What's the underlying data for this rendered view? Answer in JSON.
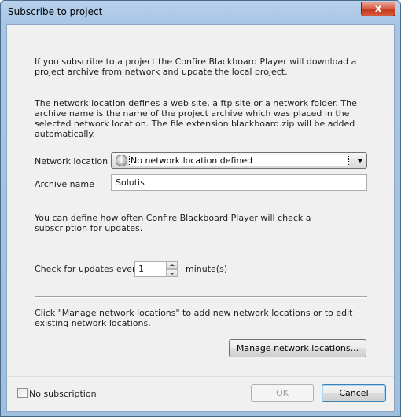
{
  "window": {
    "title": "Subscribe to project",
    "close_glyph": "x"
  },
  "intro": {
    "para1": "If you subscribe to a project the Confire Blackboard Player will download a project archive from network and update the local project.",
    "para2": "The network location defines a web site, a ftp site or a network folder. The archive name is the name of the project archive which was placed in the selected network location. The file extension blackboard.zip will be added automatically."
  },
  "form": {
    "network_location_label": "Network location",
    "network_location_value": "No network location defined",
    "network_location_icon": "info-icon",
    "archive_name_label": "Archive name",
    "archive_name_value": "Solutis"
  },
  "updates": {
    "para": "You can define how often Confire Blackboard Player will check a subscription for updates.",
    "check_label": "Check for updates every",
    "interval_value": "1",
    "unit_label": "minute(s)"
  },
  "manage": {
    "para": "Click \"Manage network locations\" to add new network locations or to edit existing network locations.",
    "button_label": "Manage network locations..."
  },
  "footer": {
    "no_subscription_label": "No subscription",
    "no_subscription_checked": false,
    "ok_label": "OK",
    "ok_enabled": false,
    "cancel_label": "Cancel"
  }
}
